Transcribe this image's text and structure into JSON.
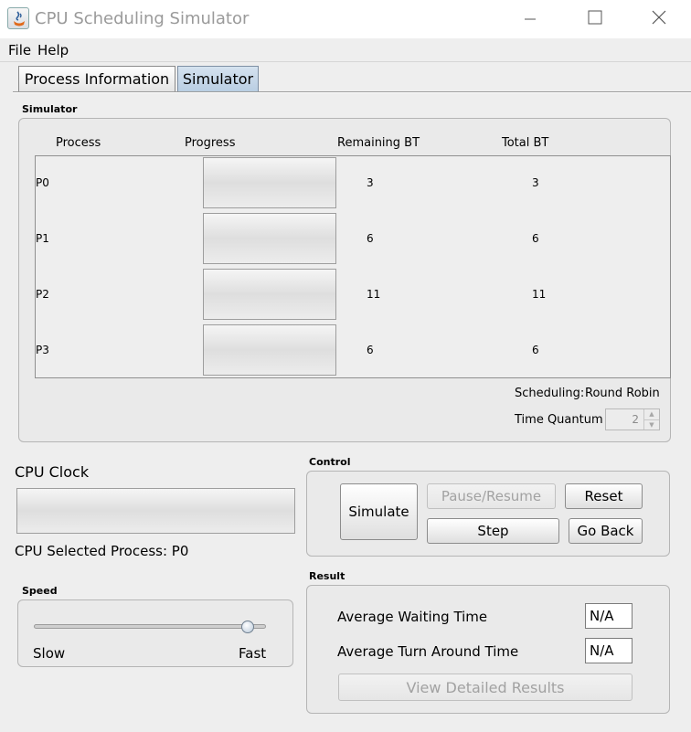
{
  "window": {
    "title": "CPU Scheduling Simulator"
  },
  "menu": {
    "items": [
      "File",
      "Help"
    ]
  },
  "tabs": [
    {
      "label": "Process Information"
    },
    {
      "label": "Simulator"
    }
  ],
  "simulator": {
    "section_title": "Simulator",
    "columns": [
      "Process",
      "Progress",
      "Remaining BT",
      "Total BT"
    ],
    "rows": [
      {
        "process": "P0",
        "progress": 0,
        "remaining_bt": "3",
        "total_bt": "3"
      },
      {
        "process": "P1",
        "progress": 0,
        "remaining_bt": "6",
        "total_bt": "6"
      },
      {
        "process": "P2",
        "progress": 0,
        "remaining_bt": "11",
        "total_bt": "11"
      },
      {
        "process": "P3",
        "progress": 0,
        "remaining_bt": "6",
        "total_bt": "6"
      }
    ],
    "scheduling_label": "Scheduling:",
    "scheduling_value": "Round Robin",
    "quantum_label": "Time Quantum",
    "quantum_value": "2"
  },
  "cpu": {
    "clock_label": "CPU Clock",
    "clock_progress": 0,
    "selected_label": "CPU Selected Process:",
    "selected_value": "P0"
  },
  "control": {
    "section_title": "Control",
    "simulate": "Simulate",
    "pause_resume": "Pause/Resume",
    "reset": "Reset",
    "step": "Step",
    "go_back": "Go Back"
  },
  "speed": {
    "section_title": "Speed",
    "min_label": "Slow",
    "max_label": "Fast",
    "level": 0.92
  },
  "result": {
    "section_title": "Result",
    "avg_waiting_label": "Average Waiting Time",
    "avg_waiting_value": "N/A",
    "avg_turnaround_label": "Average Turn Around Time",
    "avg_turnaround_value": "N/A",
    "view_details": "View Detailed Results"
  },
  "colors": {
    "title_text": "#9a9a9a",
    "disabled_text": "#a2a2a2",
    "selected_tab": "#c6d7e9"
  }
}
